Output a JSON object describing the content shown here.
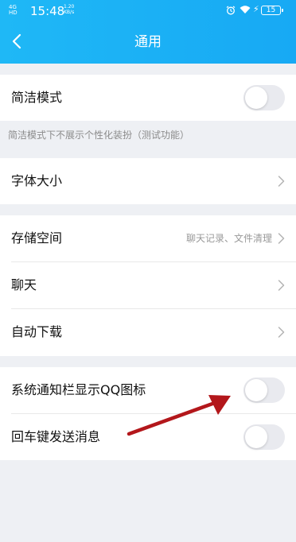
{
  "status_bar": {
    "network_top": "4G",
    "network_bottom": "HD",
    "time": "15:48",
    "speed_value": "1.20",
    "speed_unit": "KB/s",
    "battery": "15",
    "icons": [
      "alarm-icon",
      "wifi-icon",
      "charging-icon",
      "battery-icon"
    ]
  },
  "nav": {
    "title": "通用",
    "back_icon": "chevron-left-icon"
  },
  "simple_mode": {
    "label": "简洁模式",
    "toggle_on": false,
    "hint": "简洁模式下不展示个性化装扮（测试功能）"
  },
  "font_size": {
    "label": "字体大小"
  },
  "storage_group": {
    "items": [
      {
        "label": "存储空间",
        "value": "聊天记录、文件清理"
      },
      {
        "label": "聊天",
        "value": ""
      },
      {
        "label": "自动下载",
        "value": ""
      }
    ]
  },
  "notification_group": {
    "items": [
      {
        "label": "系统通知栏显示QQ图标",
        "toggle_on": false
      },
      {
        "label": "回车键发送消息",
        "toggle_on": false
      }
    ]
  },
  "colors": {
    "header": "#1fb8f6",
    "background": "#eef0f4",
    "toggle_off": "#e9eaef",
    "annotation_arrow": "#b3171b"
  }
}
